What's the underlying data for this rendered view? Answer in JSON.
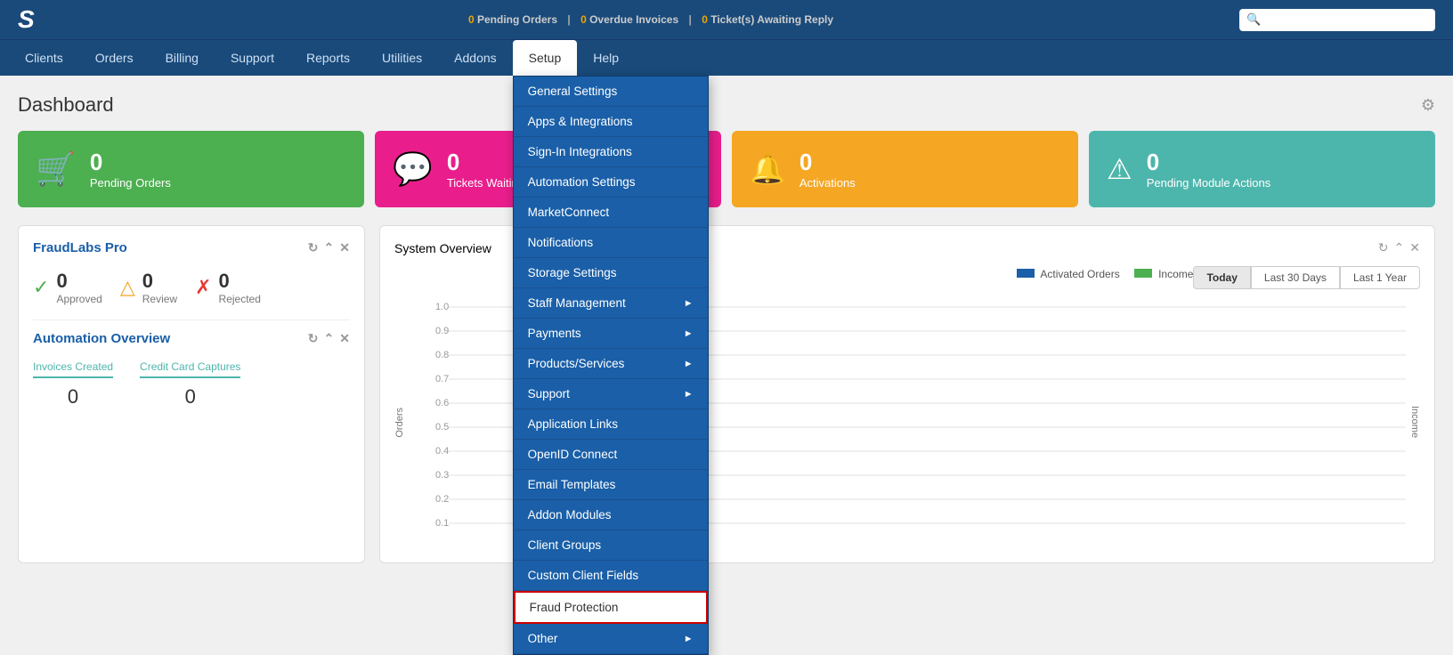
{
  "header": {
    "logo": "S",
    "alerts": {
      "pending_orders_count": "0",
      "pending_orders_label": "Pending Orders",
      "overdue_invoices_count": "0",
      "overdue_invoices_label": "Overdue Invoices",
      "tickets_count": "0",
      "tickets_label": "Ticket(s) Awaiting Reply"
    },
    "search_placeholder": ""
  },
  "nav": {
    "items": [
      {
        "label": "Clients",
        "active": false
      },
      {
        "label": "Orders",
        "active": false
      },
      {
        "label": "Billing",
        "active": false
      },
      {
        "label": "Support",
        "active": false
      },
      {
        "label": "Reports",
        "active": false
      },
      {
        "label": "Utilities",
        "active": false
      },
      {
        "label": "Addons",
        "active": false
      },
      {
        "label": "Setup",
        "active": true
      },
      {
        "label": "Help",
        "active": false
      }
    ]
  },
  "setup_dropdown": {
    "items": [
      {
        "label": "General Settings",
        "has_arrow": false,
        "highlighted": false
      },
      {
        "label": "Apps & Integrations",
        "has_arrow": false,
        "highlighted": false
      },
      {
        "label": "Sign-In Integrations",
        "has_arrow": false,
        "highlighted": false
      },
      {
        "label": "Automation Settings",
        "has_arrow": false,
        "highlighted": false
      },
      {
        "label": "MarketConnect",
        "has_arrow": false,
        "highlighted": false
      },
      {
        "label": "Notifications",
        "has_arrow": false,
        "highlighted": false
      },
      {
        "label": "Storage Settings",
        "has_arrow": false,
        "highlighted": false
      },
      {
        "label": "Staff Management",
        "has_arrow": true,
        "highlighted": false
      },
      {
        "label": "Payments",
        "has_arrow": true,
        "highlighted": false
      },
      {
        "label": "Products/Services",
        "has_arrow": true,
        "highlighted": false
      },
      {
        "label": "Support",
        "has_arrow": true,
        "highlighted": false
      },
      {
        "label": "Application Links",
        "has_arrow": false,
        "highlighted": false
      },
      {
        "label": "OpenID Connect",
        "has_arrow": false,
        "highlighted": false
      },
      {
        "label": "Email Templates",
        "has_arrow": false,
        "highlighted": false
      },
      {
        "label": "Addon Modules",
        "has_arrow": false,
        "highlighted": false
      },
      {
        "label": "Client Groups",
        "has_arrow": false,
        "highlighted": false
      },
      {
        "label": "Custom Client Fields",
        "has_arrow": false,
        "highlighted": false
      },
      {
        "label": "Fraud Protection",
        "has_arrow": false,
        "highlighted": true
      },
      {
        "label": "Other",
        "has_arrow": true,
        "highlighted": false
      }
    ]
  },
  "dashboard": {
    "title": "Dashboard",
    "stat_cards": [
      {
        "label": "Pending Orders",
        "count": "0",
        "color": "green",
        "icon": "🛒"
      },
      {
        "label": "Tickets Waiting",
        "count": "0",
        "color": "pink",
        "icon": "💬"
      },
      {
        "label": "Activations",
        "count": "0",
        "color": "orange",
        "icon": "🔔"
      },
      {
        "label": "Pending Module Actions",
        "count": "0",
        "color": "teal",
        "icon": "⚠"
      }
    ],
    "fraudlabs": {
      "title": "FraudLabs Pro",
      "approved_count": "0",
      "approved_label": "Approved",
      "review_count": "0",
      "review_label": "Review",
      "rejected_count": "0",
      "rejected_label": "Rejected"
    },
    "automation": {
      "title": "Automation Overview",
      "invoices_created_label": "Invoices Created",
      "invoices_created_count": "0",
      "credit_card_label": "Credit Card Captures",
      "credit_card_count": "0"
    },
    "system_overview": {
      "title": "System Overview",
      "tab_today": "Today",
      "tab_30days": "Last 30 Days",
      "tab_1year": "Last 1 Year",
      "tab_active": "Today",
      "legend_activated": "Activated Orders",
      "legend_income": "Income",
      "y_axis_label": "Orders",
      "y_axis_right_label": "Income",
      "y_ticks": [
        "1.0",
        "0.9",
        "0.8",
        "0.7",
        "0.6",
        "0.5",
        "0.4",
        "0.3",
        "0.2",
        "0.1"
      ]
    }
  }
}
